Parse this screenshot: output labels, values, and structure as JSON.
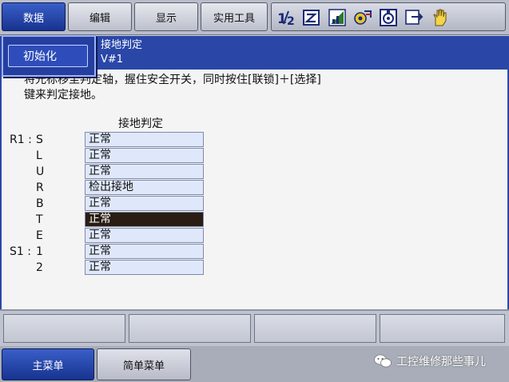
{
  "menu": {
    "items": [
      {
        "label": "数据",
        "active": true
      },
      {
        "label": "编辑",
        "active": false
      },
      {
        "label": "显示",
        "active": false
      },
      {
        "label": "实用工具",
        "active": false
      }
    ]
  },
  "toolbar_icons": [
    {
      "name": "one-two-icon",
      "glyph": "1⁄2"
    },
    {
      "name": "edit-check-icon",
      "glyph": "Z"
    },
    {
      "name": "signal-bars-icon",
      "glyph": "M"
    },
    {
      "name": "gear-cycle-icon",
      "glyph": "⚙"
    },
    {
      "name": "servo-icon",
      "glyph": "◎"
    },
    {
      "name": "exit-icon",
      "glyph": "⇲"
    },
    {
      "name": "hand-icon",
      "glyph": "✋"
    }
  ],
  "dropdown": {
    "item_label": "初始化"
  },
  "title": {
    "line1": "接地判定",
    "line2": "V#1"
  },
  "instructions": {
    "line1": "将光标移至判定轴，握住安全开关，同时按住[联锁]＋[选择]",
    "line2": "键来判定接地。"
  },
  "table": {
    "header": "接地判定",
    "rows": [
      {
        "prefix": "R1 :",
        "axis": "S",
        "status": "正常",
        "selected": false
      },
      {
        "prefix": "",
        "axis": "L",
        "status": "正常",
        "selected": false
      },
      {
        "prefix": "",
        "axis": "U",
        "status": "正常",
        "selected": false
      },
      {
        "prefix": "",
        "axis": "R",
        "status": "检出接地",
        "selected": false
      },
      {
        "prefix": "",
        "axis": "B",
        "status": "正常",
        "selected": false
      },
      {
        "prefix": "",
        "axis": "T",
        "status": "正常",
        "selected": true
      },
      {
        "prefix": "",
        "axis": "E",
        "status": "正常",
        "selected": false
      },
      {
        "prefix": "S1 :",
        "axis": "1",
        "status": "正常",
        "selected": false
      },
      {
        "prefix": "",
        "axis": "2",
        "status": "正常",
        "selected": false
      }
    ]
  },
  "bottom": {
    "main_menu": "主菜单",
    "simple_menu": "简单菜单"
  },
  "watermark": "工控维修那些事儿",
  "colors": {
    "accent_blue": "#2a47a8",
    "selected_cell": "#2a1d12",
    "cell_bg": "#dfe8fb"
  }
}
